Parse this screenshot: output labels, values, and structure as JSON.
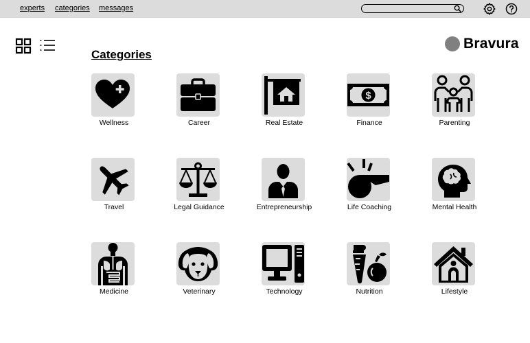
{
  "nav": {
    "links": [
      "experts",
      "categories",
      "messages"
    ]
  },
  "search": {
    "placeholder": ""
  },
  "brand": {
    "name": "Bravura",
    "logo_color": "#808080"
  },
  "page": {
    "title": "Categories"
  },
  "colors": {
    "topbar": "#dcdcdc",
    "tile": "#dcdcdc",
    "icon": "#000000"
  },
  "categories": [
    {
      "label": "Wellness",
      "icon": "heart-plus-icon"
    },
    {
      "label": "Career",
      "icon": "briefcase-icon"
    },
    {
      "label": "Real Estate",
      "icon": "house-sign-icon"
    },
    {
      "label": "Finance",
      "icon": "money-bill-icon"
    },
    {
      "label": "Parenting",
      "icon": "family-icon"
    },
    {
      "label": "Travel",
      "icon": "airplane-icon"
    },
    {
      "label": "Legal Guidance",
      "icon": "scales-icon"
    },
    {
      "label": "Entrepreneurship",
      "icon": "businessman-icon"
    },
    {
      "label": "Life Coaching",
      "icon": "whistle-icon"
    },
    {
      "label": "Mental Health",
      "icon": "head-brain-icon"
    },
    {
      "label": "Medicine",
      "icon": "anatomy-icon"
    },
    {
      "label": "Veterinary",
      "icon": "dog-icon"
    },
    {
      "label": "Technology",
      "icon": "computer-icon"
    },
    {
      "label": "Nutrition",
      "icon": "carrot-apple-icon"
    },
    {
      "label": "Lifestyle",
      "icon": "home-icon"
    }
  ]
}
